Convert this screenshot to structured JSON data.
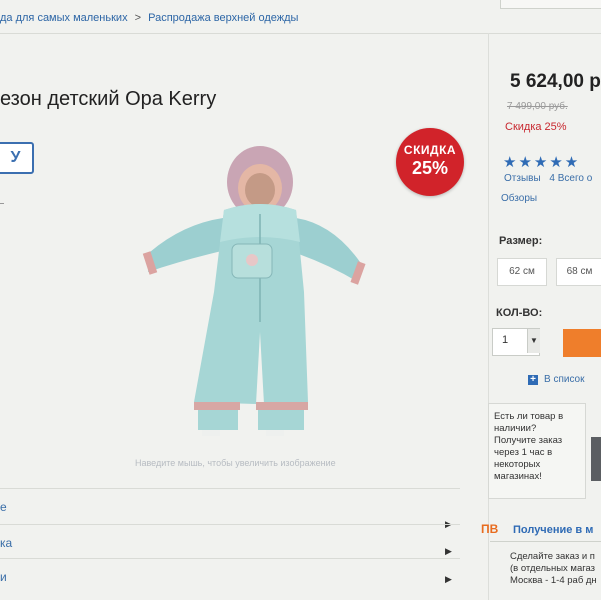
{
  "breadcrumbs": [
    "да для самых маленьких",
    ">",
    "Распродажа верхней одежды"
  ],
  "product": {
    "title": "езон детский Opa Kerry",
    "brand_logo": "У",
    "photo_hint": "Наведите мышь, чтобы увеличить изображение",
    "badge": {
      "line1": "СКИДКА",
      "line2": "25%"
    }
  },
  "pricing": {
    "price": "5 624,00 р",
    "old_price": "7 499,00 руб.",
    "discount": "Скидка 25%"
  },
  "rating": {
    "stars": "★★★★★",
    "reviews_link": "Отзывы",
    "reviews_count": "4 Всего о",
    "reviews_tab": "Обзоры"
  },
  "sizes": {
    "label": "Размер:",
    "options": [
      "62 см",
      "68 см"
    ]
  },
  "quantity": {
    "label": "КОЛ-ВО:",
    "value": "1",
    "arrow": "▼"
  },
  "wishlist": {
    "label": "В список"
  },
  "availability": {
    "lines": [
      "Есть ли товар в",
      "наличии?",
      "Получите заказ",
      "через 1 час в",
      "некоторых",
      "магазинах!"
    ]
  },
  "delivery": {
    "icon": "ПВ",
    "title": "Получение в м",
    "lines": [
      "Сделайте заказ и п",
      "(в отдельных магаз",
      "Москва - 1-4 раб дн"
    ]
  },
  "left_menu": {
    "items": [
      "е",
      "ка",
      "и"
    ]
  },
  "colors": {
    "accent_blue": "#2f6bb5",
    "sale_red": "#d1232a",
    "cart_orange": "#ef7e2b"
  }
}
